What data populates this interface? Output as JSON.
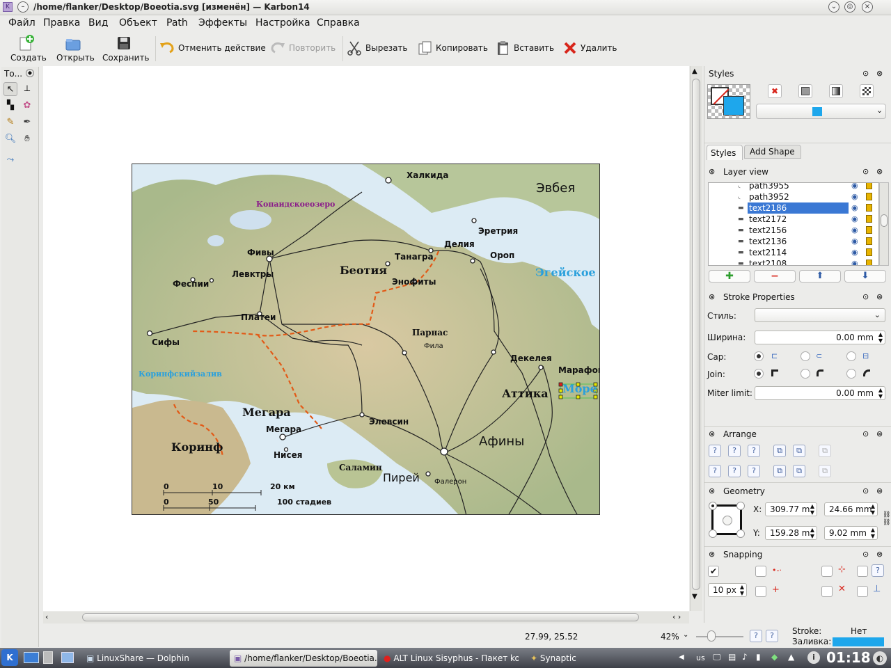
{
  "window": {
    "title": "/home/flanker/Desktop/Boeotia.svg [изменён] — Karbon14"
  },
  "menu": [
    "Файл",
    "Правка",
    "Вид",
    "Объект",
    "Path",
    "Эффекты",
    "Настройка",
    "Справка"
  ],
  "toolbar": {
    "new": "Создать",
    "open": "Открыть",
    "save": "Сохранить",
    "undo": "Отменить действие",
    "redo": "Повторить",
    "cut": "Вырезать",
    "copy": "Копировать",
    "paste": "Вставить",
    "delete": "Удалить"
  },
  "toolbox": {
    "title": "То..."
  },
  "map": {
    "labels": {
      "khalkida": "Халкида",
      "evbeya": "Эвбея",
      "kopaida": "Копаидскоеозеро",
      "eretria": "Эретрия",
      "fivy": "Фивы",
      "tanagra": "Танагра",
      "deliya": "Делия",
      "orop": "Ороп",
      "levktry": "Левктры",
      "beotiya": "Беотия",
      "fespii": "Феспии",
      "enofity": "Энофиты",
      "egeyskoe": "Эгейское",
      "platei": "Платеи",
      "parnas": "Парнас",
      "fila": "Фила",
      "sify": "Сифы",
      "dekeleya": "Декелея",
      "marafon": "Марафон",
      "korinfzaliv": "Коринфскийзалив",
      "more": "Море",
      "attika": "Аттика",
      "megara_region": "Мегара",
      "elevsin": "Элевсин",
      "megara_city": "Мегара",
      "afiny": "Афины",
      "korinf": "Коринф",
      "nisea": "Нисея",
      "salamin": "Саламин",
      "pirey": "Пирей",
      "faleron": "Фалерон"
    },
    "scale": {
      "t0": "0",
      "t10": "10",
      "t20": "20 км",
      "b0": "0",
      "b50": "50",
      "b100": "100 стадиев"
    }
  },
  "panels": {
    "styles": {
      "title": "Styles",
      "tab1": "Styles",
      "tab2": "Add Shape",
      "fill_color": "#1ea7ec"
    },
    "layer_view": {
      "title": "Layer view",
      "items": [
        "path3955",
        "path3952",
        "text2186",
        "text2172",
        "text2156",
        "text2136",
        "text2114",
        "text2108"
      ],
      "selected": "text2186"
    },
    "stroke": {
      "title": "Stroke Properties",
      "style_label": "Стиль:",
      "width_label": "Ширина:",
      "width_value": "0.00 mm",
      "cap_label": "Cap:",
      "join_label": "Join:",
      "miter_label": "Miter limit:",
      "miter_value": "0.00 mm"
    },
    "arrange": {
      "title": "Arrange"
    },
    "geometry": {
      "title": "Geometry",
      "x_label": "X:",
      "x_value": "309.77 m",
      "w_value": "24.66 mm",
      "y_label": "Y:",
      "y_value": "159.28 m",
      "h_value": "9.02 mm"
    },
    "snapping": {
      "title": "Snapping",
      "distance": "10 px"
    }
  },
  "status": {
    "coords": "27.99, 25.52",
    "zoom": "42%",
    "stroke_label": "Stroke:",
    "stroke_value": "Нет",
    "fill_label": "Заливка:",
    "fill_color": "#1ea7ec"
  },
  "taskbar": {
    "tasks": [
      "LinuxShare — Dolphin",
      "/home/flanker/Desktop/Boeotia.s",
      "ALT Linux Sisyphus - Пакет kofl",
      "Synaptic"
    ],
    "layout": "us",
    "clock": "01:18"
  }
}
